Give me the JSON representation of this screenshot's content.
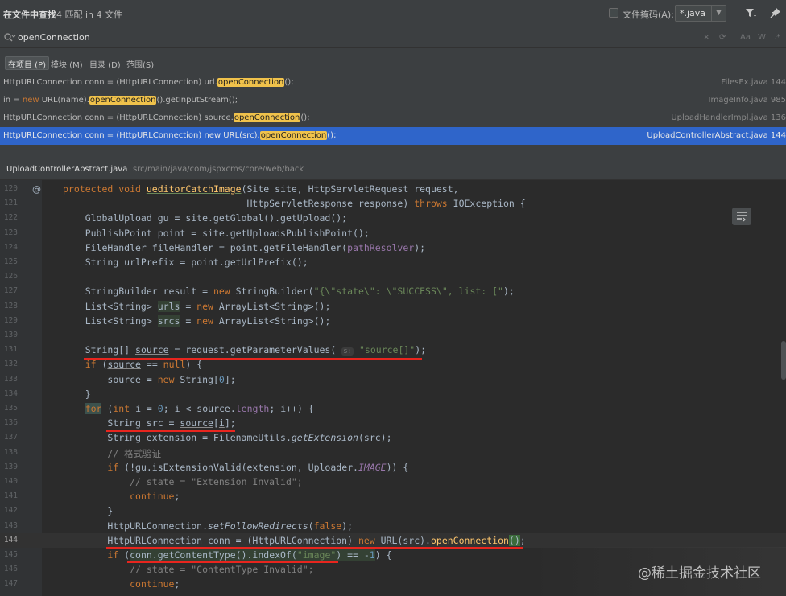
{
  "header": {
    "title": "在文件中查找",
    "match_summary": "4 匹配 in 4 文件",
    "file_mask_label": "文件掩码(A):",
    "file_mask_value": "*.java"
  },
  "search": {
    "query": "openConnection",
    "tool_icons": [
      "×",
      "⟳",
      "Aa",
      "W",
      ".*"
    ]
  },
  "scopes": [
    {
      "label": "在项目 (P)",
      "active": true
    },
    {
      "label": "模块 (M)",
      "active": false
    },
    {
      "label": "目录 (D)",
      "active": false
    },
    {
      "label": "范围(S)",
      "active": false
    }
  ],
  "results": [
    {
      "before": "HttpURLConnection conn = (HttpURLConnection) url.",
      "new": "",
      "mid": "",
      "match": "openConnection",
      "after": "();",
      "file": "FilesEx.java 144"
    },
    {
      "before": "in = ",
      "new": "new",
      "mid": " URL(name).",
      "match": "openConnection",
      "after": "().getInputStream();",
      "file": "ImageInfo.java 985"
    },
    {
      "before": "HttpURLConnection conn = (HttpURLConnection) source.",
      "new": "",
      "mid": "",
      "match": "openConnection",
      "after": "();",
      "file": "UploadHandlerImpl.java 136"
    },
    {
      "before": "HttpURLConnection conn = (HttpURLConnection) new URL(src).",
      "new": "",
      "mid": "",
      "match": "openConnection",
      "after": "();",
      "file": "UploadControllerAbstract.java 144",
      "selected": true
    }
  ],
  "preview": {
    "file": "UploadControllerAbstract.java",
    "path": "src/main/java/com/jspxcms/core/web/back"
  },
  "code": {
    "line_numbers": [
      "120",
      "121",
      "122",
      "123",
      "124",
      "125",
      "126",
      "127",
      "128",
      "129",
      "130",
      "131",
      "132",
      "133",
      "134",
      "135",
      "136",
      "137",
      "138",
      "139",
      "140",
      "141",
      "142",
      "143",
      "144",
      "145",
      "146",
      "147"
    ],
    "current_line": "144",
    "hint_s": "s:",
    "comments": {
      "l138": "// 格式验证",
      "l140": "// state = \"Extension Invalid\";",
      "l146": "// state = \"ContentType Invalid\";"
    }
  },
  "watermark": "@稀土掘金技术社区",
  "colors": {
    "background": "#2b2b2b",
    "panel": "#3c3f41",
    "selection": "#2f65ca",
    "match_highlight": "#f0c24b",
    "keyword": "#cc7832",
    "string": "#6a8759",
    "annotation_red": "#e8251e"
  }
}
